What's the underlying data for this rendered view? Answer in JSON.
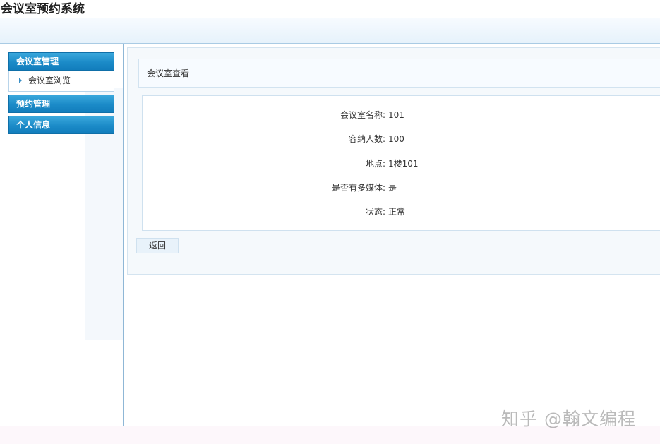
{
  "app": {
    "title": "会议室预约系统"
  },
  "sidebar": {
    "sections": [
      {
        "label": "会议室管理",
        "items": [
          {
            "label": "会议室浏览"
          }
        ]
      },
      {
        "label": "预约管理"
      },
      {
        "label": "个人信息"
      }
    ]
  },
  "main": {
    "panel_title": "会议室查看",
    "fields": [
      {
        "label": "会议室名称:",
        "value": "101"
      },
      {
        "label": "容纳人数:",
        "value": "100"
      },
      {
        "label": "地点:",
        "value": "1楼101"
      },
      {
        "label": "是否有多媒体:",
        "value": "是"
      },
      {
        "label": "状态:",
        "value": "正常"
      }
    ],
    "back_label": "返回"
  },
  "watermark": "知乎 @翰文编程"
}
